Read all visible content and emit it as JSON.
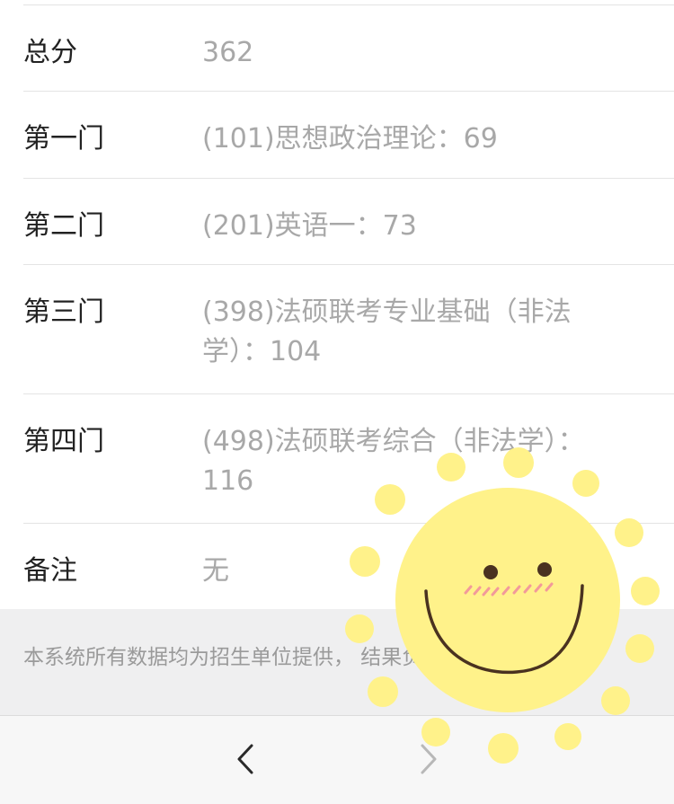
{
  "rows": [
    {
      "label": "总分",
      "value": "362"
    },
    {
      "label": "第一门",
      "value": "(101)思想政治理论：69"
    },
    {
      "label": "第二门",
      "value": "(201)英语一：73"
    },
    {
      "label": "第三门",
      "value": "(398)法硕联考专业基础（非法学）：104"
    },
    {
      "label": "第四门",
      "value": "(498)法硕联考综合（非法学）：116"
    },
    {
      "label": "备注",
      "value": "无"
    }
  ],
  "footer": {
    "note_visible": "本系统所有数据均为招生单位提供，                              结果负责解释。"
  },
  "toolbar": {
    "back_icon": "chevron-left-icon",
    "forward_icon": "chevron-right-icon"
  },
  "sticker": {
    "icon": "smiling-sun-sticker",
    "fill_color": "#fff28a",
    "face_color": "#4a3220",
    "blush_color": "#f29a9a"
  }
}
